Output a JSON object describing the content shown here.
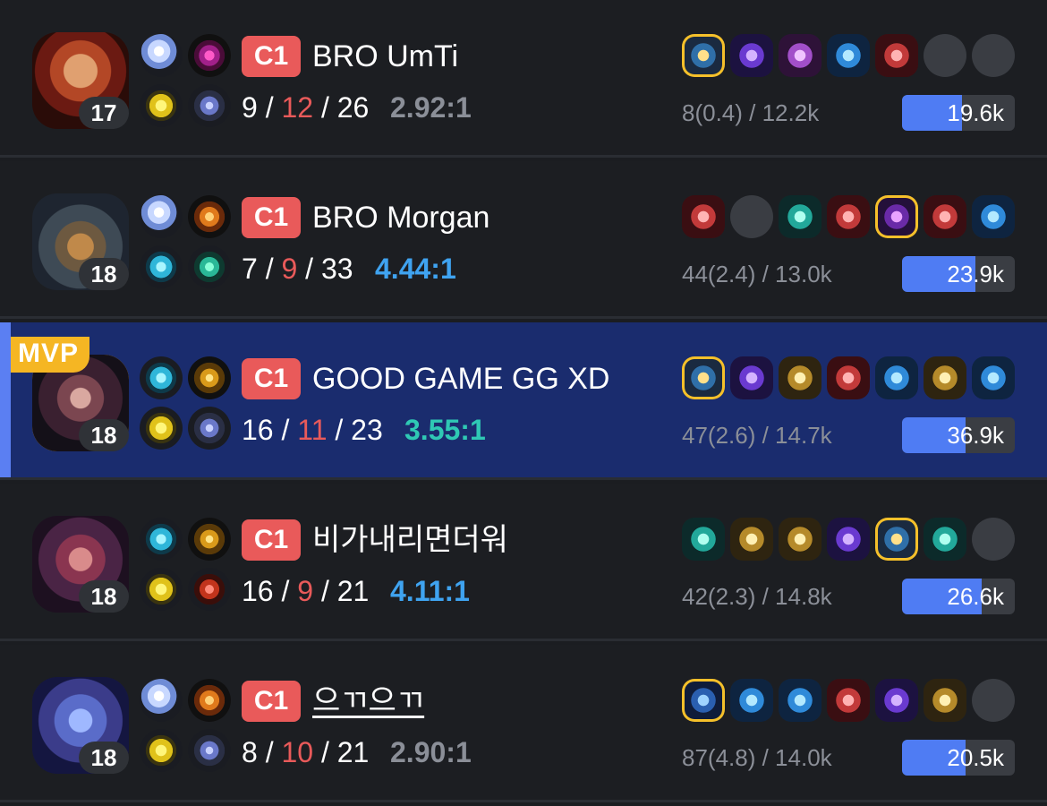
{
  "mvp_label": "MVP",
  "players": [
    {
      "level": "17",
      "tier": "C1",
      "name": "BRO UmTi",
      "kills": "9",
      "deaths": "12",
      "assists": "26",
      "kda": "2.92:1",
      "kda_color": "#8b8f98",
      "cs": "8(0.4) / 12.2k",
      "damage": "19.6k",
      "damage_fraction": 0.53,
      "champ_icon": "champion-portrait-red-hair",
      "spells": [
        "glacial-augment-icon",
        "dark-harvest-icon",
        "flash-icon",
        "ghost-rune-icon"
      ],
      "items": [
        "item-golden",
        "item-purple",
        "item-violet",
        "item-blue",
        "item-red",
        "empty",
        "empty"
      ]
    },
    {
      "level": "18",
      "tier": "C1",
      "name": "BRO Morgan",
      "kills": "7",
      "deaths": "9",
      "assists": "33",
      "kda": "4.44:1",
      "kda_color": "#3fa3f0",
      "cs": "44(2.4) / 13.0k",
      "damage": "23.9k",
      "damage_fraction": 0.65,
      "champ_icon": "champion-portrait-helmet",
      "spells": [
        "glacial-augment-icon",
        "aftershock-icon",
        "teleport-icon",
        "resolve-rune-icon"
      ],
      "items": [
        "item-red",
        "empty",
        "item-teal",
        "item-red",
        "item-golden-purple",
        "item-red",
        "item-blue"
      ]
    },
    {
      "level": "18",
      "tier": "C1",
      "name": "GOOD GAME GG XD",
      "kills": "16",
      "deaths": "11",
      "assists": "23",
      "kda": "3.55:1",
      "kda_color": "#2fc8b4",
      "cs": "47(2.6) / 14.7k",
      "damage": "36.9k",
      "damage_fraction": 0.56,
      "champ_icon": "champion-portrait-dark",
      "mvp": true,
      "spells": [
        "teleport-icon",
        "conqueror-icon",
        "flash-icon",
        "ghost-rune-icon"
      ],
      "items": [
        "item-golden",
        "item-purple",
        "item-gold",
        "item-red",
        "item-blue",
        "item-gold",
        "item-blue"
      ]
    },
    {
      "level": "18",
      "tier": "C1",
      "name": "비가내리면더워",
      "kills": "16",
      "deaths": "9",
      "assists": "21",
      "kda": "4.11:1",
      "kda_color": "#3fa3f0",
      "cs": "42(2.3) / 14.8k",
      "damage": "26.6k",
      "damage_fraction": 0.71,
      "champ_icon": "champion-portrait-vayne",
      "spells": [
        "teleport-icon",
        "conqueror-icon",
        "flash-icon",
        "domination-rune-icon"
      ],
      "items": [
        "item-teal",
        "item-gold",
        "item-gold",
        "item-purple",
        "item-golden",
        "item-teal",
        "empty"
      ]
    },
    {
      "level": "18",
      "tier": "C1",
      "name": "으ㄲ으ㄲ",
      "kills": "8",
      "deaths": "10",
      "assists": "21",
      "kda": "2.90:1",
      "kda_color": "#8b8f98",
      "cs": "87(4.8) / 14.0k",
      "damage": "20.5k",
      "damage_fraction": 0.56,
      "champ_icon": "champion-portrait-ryze",
      "underline": true,
      "spells": [
        "glacial-augment-icon",
        "aftershock-icon",
        "flash-icon",
        "ghost-rune-icon"
      ],
      "items": [
        "item-golden-blue",
        "item-blue",
        "item-blue",
        "item-red",
        "item-purple",
        "item-gold",
        "empty"
      ]
    }
  ]
}
